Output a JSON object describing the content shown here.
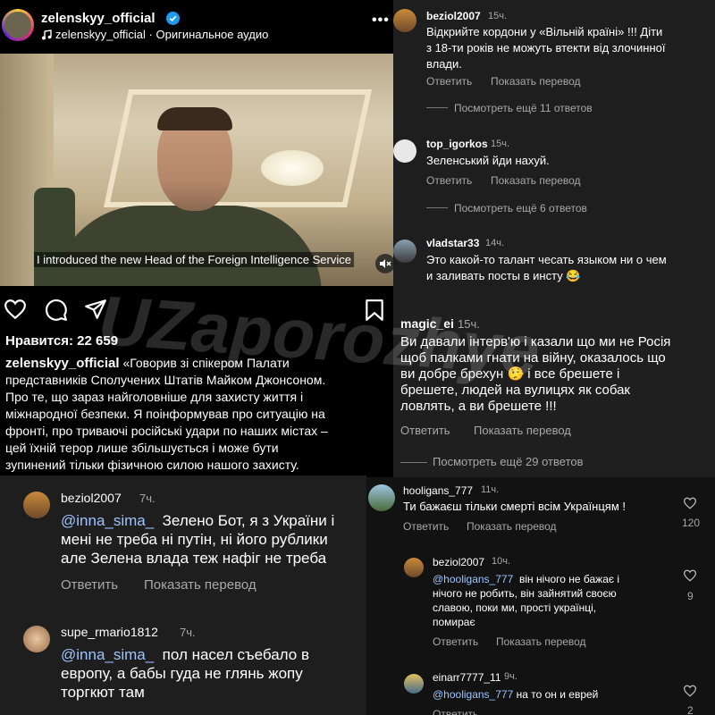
{
  "post": {
    "username": "zelenskyy_official",
    "audio_label": "zelenskyy_official · Оригинальное аудио",
    "more_icon": "more-icon",
    "video_caption": "I introduced the new Head of the Foreign Intelligence Service",
    "likes": "Нравится: 22 659",
    "caption_user": "zelenskyy_official",
    "caption_lines": [
      "«Говорив зі спікером Палати",
      "представників Сполучених Штатів Майком Джонсоном.",
      "Про те, що зараз найголовніше для захисту життя і",
      "міжнародної безпеки. Я поінформував про ситуацію на",
      "фронті, про триваючі російські удари по наших містах –",
      "цей їхній терор лише збільшується і може бути",
      "зупинений тільки фізичною силою нашого захисту."
    ]
  },
  "watermark": "UZaporozhye",
  "labels": {
    "reply": "Ответить",
    "translate": "Показать перевод"
  },
  "right_top_comments": [
    {
      "user": "beziol2007",
      "time": "15ч.",
      "lines": [
        "Відкрийте кордони у «Вільній країні» !!! Діти",
        "з 18-ти років не можуть втекти від злочинної",
        "влади."
      ],
      "more": "Посмотреть ещё 11 ответов"
    },
    {
      "user": "top_igorkos",
      "time": "15ч.",
      "lines": [
        "Зеленський йди нахуй."
      ],
      "more": "Посмотреть ещё 6 ответов"
    },
    {
      "user": "vladstar33",
      "time": "14ч.",
      "lines": [
        "Это какой-то талант чесать языком ни о чем",
        "и заливать посты в инсту 😂"
      ]
    }
  ],
  "magic_comment": {
    "user": "magic_ei",
    "time": "15ч.",
    "lines": [
      "Ви давали інтерв'ю і казали що ми не Росія",
      "щоб палками гнати на війну, оказалось що",
      "ви добре брехун 🤥 і все брешете і",
      "брешете, людей на вулицях як собак",
      "ловлять, а ви брешете !!!"
    ],
    "more": "Посмотреть ещё 29 ответов"
  },
  "right_bottom_comments": [
    {
      "user": "hooligans_777",
      "time": "11ч.",
      "lines": [
        "Ти бажаєш тільки смерті всім Українцям !"
      ],
      "likes": "120"
    },
    {
      "user": "beziol2007",
      "time": "10ч.",
      "mention": "@hooligans_777",
      "lines": [
        "він нічого не бажає і",
        "нічого не робить, він зайнятий своєю",
        "славою, поки ми, прості українці,",
        "помирає"
      ],
      "likes": "9"
    },
    {
      "user": "einarr7777_11",
      "time": "9ч.",
      "mention": "@hooligans_777",
      "lines": [
        "на то он и еврей"
      ],
      "likes": "2",
      "reply_cut": "Ответить"
    }
  ],
  "left_bottom_comments": [
    {
      "user": "beziol2007",
      "time": "7ч.",
      "mention": "@inna_sima_",
      "lines": [
        "Зелено Бот, я з України і",
        "мені не треба ні путін, ні його рублики",
        "але Зелена влада теж нафіг не треба"
      ]
    },
    {
      "user": "supe_rmario1812",
      "time": "7ч.",
      "mention": "@inna_sima_",
      "lines": [
        "пол насел съебало в",
        "европу, а бабы гуда не глянь жопу",
        "торгкют там"
      ]
    }
  ],
  "colors": {
    "verified": "#1d9bf0",
    "panel": "#1e1e1e",
    "mention": "#9ec3ff"
  }
}
